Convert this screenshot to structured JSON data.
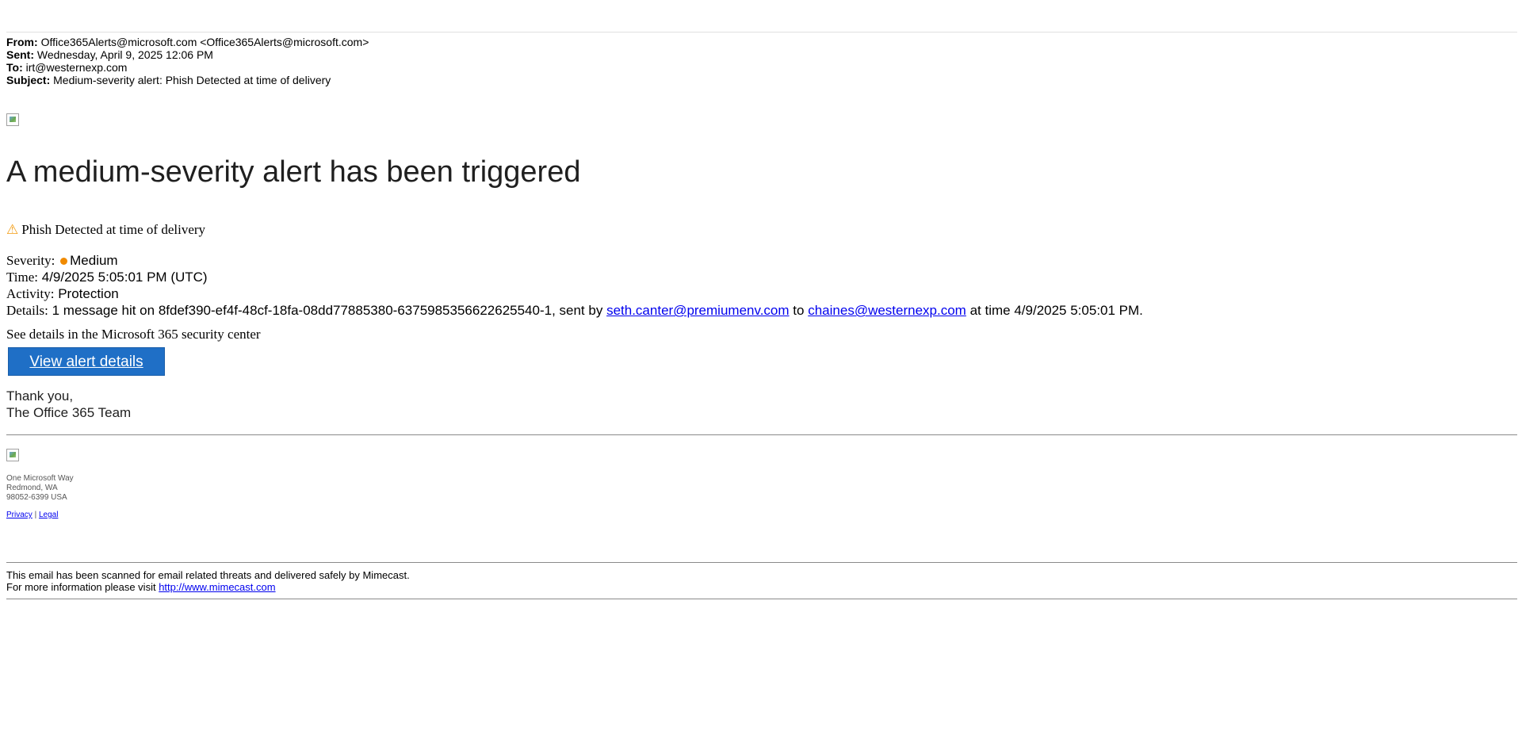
{
  "email_headers": {
    "from_label": "From:",
    "from_value": "Office365Alerts@microsoft.com <Office365Alerts@microsoft.com>",
    "sent_label": "Sent:",
    "sent_value": "Wednesday, April 9, 2025 12:06 PM",
    "to_label": "To:",
    "to_value": "irt@westernexp.com",
    "subject_label": "Subject:",
    "subject_value": "Medium-severity alert: Phish Detected at time of delivery"
  },
  "body": {
    "headline": "A medium-severity alert has been triggered",
    "alert_icon": "warning-icon",
    "alert_name": "Phish Detected at time of delivery",
    "severity_label": "Severity:",
    "severity_value": "Medium",
    "severity_color": "#f08a00",
    "time_label": "Time:",
    "time_value": "4/9/2025 5:05:01 PM (UTC)",
    "activity_label": "Activity:",
    "activity_value": "Protection",
    "details_label": "Details:",
    "details_prefix": "1 message hit on 8fdef390-ef4f-48cf-18fa-08dd77885380-6375985356622625540-1, sent by",
    "sender_link": "seth.canter@premiumenv.com",
    "details_to": "to",
    "recipient_link": "chaines@westernexp.com",
    "details_suffix": "at time 4/9/2025 5:05:01 PM.",
    "see_details": "See details in the Microsoft 365 security center",
    "view_button": "View alert details",
    "button_color": "#1f6fc6",
    "thank_you": "Thank you,",
    "team": "The Office 365 Team"
  },
  "footer": {
    "address_line1": "One Microsoft Way",
    "address_line2": "Redmond, WA",
    "address_line3": "98052-6399 USA",
    "privacy_link": "Privacy",
    "separator": "|",
    "legal_link": "Legal"
  },
  "mimecast": {
    "line1": "This email has been scanned for email related threats and delivered safely by Mimecast.",
    "line2_prefix": "For more information please visit",
    "link": "http://www.mimecast.com"
  }
}
